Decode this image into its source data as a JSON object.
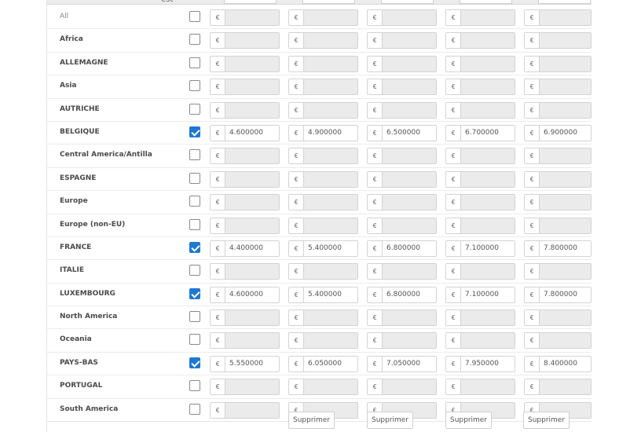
{
  "header": {
    "column_label": "est",
    "currency": "€"
  },
  "zones": [
    {
      "name": "All",
      "checked": false,
      "prices": [
        "",
        "",
        "",
        "",
        ""
      ]
    },
    {
      "name": "Africa",
      "checked": false,
      "prices": [
        "",
        "",
        "",
        "",
        ""
      ]
    },
    {
      "name": "ALLEMAGNE",
      "checked": false,
      "prices": [
        "",
        "",
        "",
        "",
        ""
      ]
    },
    {
      "name": "Asia",
      "checked": false,
      "prices": [
        "",
        "",
        "",
        "",
        ""
      ]
    },
    {
      "name": "AUTRICHE",
      "checked": false,
      "prices": [
        "",
        "",
        "",
        "",
        ""
      ]
    },
    {
      "name": "BELGIQUE",
      "checked": true,
      "prices": [
        "4.600000",
        "4.900000",
        "6.500000",
        "6.700000",
        "6.900000"
      ]
    },
    {
      "name": "Central America/Antilla",
      "checked": false,
      "prices": [
        "",
        "",
        "",
        "",
        ""
      ]
    },
    {
      "name": "ESPAGNE",
      "checked": false,
      "prices": [
        "",
        "",
        "",
        "",
        ""
      ]
    },
    {
      "name": "Europe",
      "checked": false,
      "prices": [
        "",
        "",
        "",
        "",
        ""
      ]
    },
    {
      "name": "Europe (non-EU)",
      "checked": false,
      "prices": [
        "",
        "",
        "",
        "",
        ""
      ]
    },
    {
      "name": "FRANCE",
      "checked": true,
      "prices": [
        "4.400000",
        "5.400000",
        "6.800000",
        "7.100000",
        "7.800000"
      ]
    },
    {
      "name": "ITALIE",
      "checked": false,
      "prices": [
        "",
        "",
        "",
        "",
        ""
      ]
    },
    {
      "name": "LUXEMBOURG",
      "checked": true,
      "prices": [
        "4.600000",
        "5.400000",
        "6.800000",
        "7.100000",
        "7.800000"
      ]
    },
    {
      "name": "North America",
      "checked": false,
      "prices": [
        "",
        "",
        "",
        "",
        ""
      ]
    },
    {
      "name": "Oceania",
      "checked": false,
      "prices": [
        "",
        "",
        "",
        "",
        ""
      ]
    },
    {
      "name": "PAYS-BAS",
      "checked": true,
      "prices": [
        "5.550000",
        "6.050000",
        "7.050000",
        "7.950000",
        "8.400000"
      ]
    },
    {
      "name": "PORTUGAL",
      "checked": false,
      "prices": [
        "",
        "",
        "",
        "",
        ""
      ]
    },
    {
      "name": "South America",
      "checked": false,
      "prices": [
        "",
        "",
        "",
        "",
        ""
      ]
    }
  ],
  "actions": {
    "delete_label": "Supprimer"
  }
}
